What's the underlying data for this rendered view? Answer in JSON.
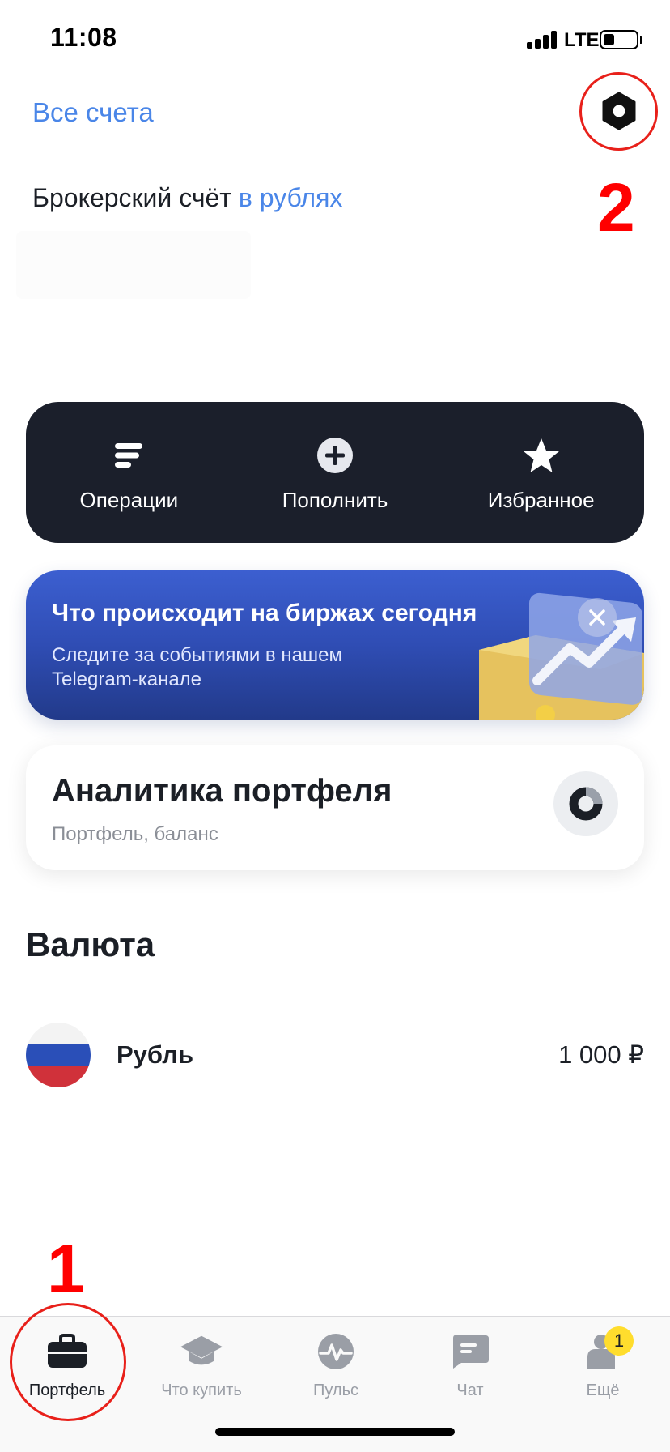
{
  "status_bar": {
    "time": "11:08",
    "network": "LTE"
  },
  "header": {
    "all_accounts_label": "Все счета",
    "account_type": "Брокерский счёт",
    "account_currency": "в рублях"
  },
  "quick_actions": [
    {
      "label": "Операции",
      "icon": "operations-icon"
    },
    {
      "label": "Пополнить",
      "icon": "plus-circle-icon"
    },
    {
      "label": "Избранное",
      "icon": "star-icon"
    }
  ],
  "promo": {
    "title": "Что происходит на биржах сегодня",
    "text": "Следите за событиями в нашем Telegram-канале"
  },
  "analytics": {
    "title": "Аналитика портфеля",
    "subtitle": "Портфель, баланс"
  },
  "currency_section": {
    "title": "Валюта",
    "items": [
      {
        "name": "Рубль",
        "value": "1 000 ₽",
        "flag_colors": [
          "#f3f3f3",
          "#2a4fb8",
          "#d0313a"
        ]
      }
    ]
  },
  "tab_bar": {
    "tabs": [
      {
        "label": "Портфель",
        "icon": "briefcase-icon",
        "active": true
      },
      {
        "label": "Что купить",
        "icon": "graduation-cap-icon",
        "active": false
      },
      {
        "label": "Пульс",
        "icon": "pulse-icon",
        "active": false
      },
      {
        "label": "Чат",
        "icon": "chat-icon",
        "active": false
      },
      {
        "label": "Ещё",
        "icon": "more-icon",
        "active": false,
        "badge": "1"
      }
    ]
  },
  "annotations": {
    "marker_1": "1",
    "marker_2": "2"
  },
  "colors": {
    "accent": "#4a86e8",
    "dark_card": "#1b1f2b",
    "annotation": "#ff0000",
    "badge": "#ffdd2d"
  }
}
